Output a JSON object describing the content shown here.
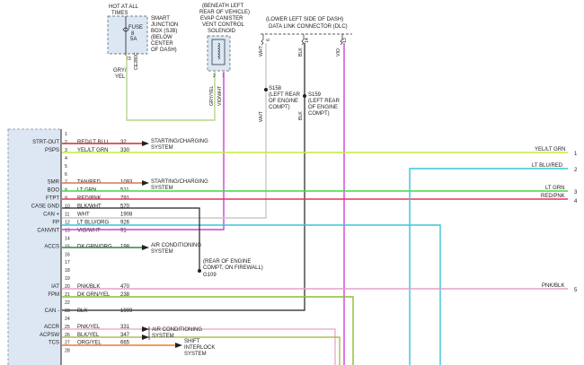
{
  "header": {
    "fuse_box_note": [
      "HOT AT ALL",
      "TIMES"
    ],
    "fuse_box_label": [
      "SMART",
      "JUNCTION",
      "BOX (SJB)",
      "(BELOW",
      "CENTER",
      "OF DASH)"
    ],
    "fuse_name": "FUSE",
    "fuse_number": "8",
    "fuse_rating": "5A",
    "fuse_pin": "23",
    "fuse_circuit": "CE280C",
    "fuse_wire_color": [
      "GRY/",
      "YEL"
    ],
    "evap_label": [
      "(BENEATH LEFT",
      "REAR OF VEHICLE)",
      "EVAP CANISTER",
      "VENT CONTROL",
      "SOLENOID"
    ],
    "evap_pin_1": "2",
    "evap_pin_2": "1",
    "evap_wire_1": "GRY/YEL",
    "evap_wire_2": "VIO/WHT",
    "dlc_label": [
      "(LOWER LEFT SIDE OF DASH)",
      "DATA LINK CONNECTOR (DLC)"
    ],
    "dlc_pins": [
      "6",
      "14",
      "13"
    ],
    "dlc_wires": [
      "WHT",
      "BLK",
      "VIO"
    ],
    "splice_s158": [
      "S158",
      "(LEFT REAR",
      "OF ENGINE",
      "COMPT)"
    ],
    "splice_s159": [
      "S159",
      "(LEFT REAR",
      "OF ENGINE",
      "COMPT)"
    ],
    "splice_wire_wht": "WHT",
    "splice_wire_blk": "BLK",
    "ground_label": [
      "(REAR OF ENGINE",
      "COMPT, ON FIREWALL)",
      "G109"
    ]
  },
  "pins": [
    {
      "n": "1",
      "name": "",
      "color": "",
      "circuit": ""
    },
    {
      "n": "2",
      "name": "STRT-OUT",
      "color": "RED/LT BLU",
      "circuit": "32"
    },
    {
      "n": "3",
      "name": "PSPS",
      "color": "YEL/LT GRN",
      "circuit": "330"
    },
    {
      "n": "4",
      "name": "",
      "color": "",
      "circuit": ""
    },
    {
      "n": "5",
      "name": "",
      "color": "",
      "circuit": ""
    },
    {
      "n": "6",
      "name": "",
      "color": "",
      "circuit": ""
    },
    {
      "n": "7",
      "name": "SMR",
      "color": "TAN/RED",
      "circuit": "1093"
    },
    {
      "n": "8",
      "name": "BOO",
      "color": "LT GRN",
      "circuit": "511"
    },
    {
      "n": "9",
      "name": "FTPT",
      "color": "RED/PNK",
      "circuit": "791"
    },
    {
      "n": "10",
      "name": "CASE GND",
      "color": "BLK/WHT",
      "circuit": "570"
    },
    {
      "n": "11",
      "name": "CAN +",
      "color": "WHT",
      "circuit": "1908"
    },
    {
      "n": "12",
      "name": "FP",
      "color": "LT BLU/ORG",
      "circuit": "926"
    },
    {
      "n": "13",
      "name": "CANVNT",
      "color": "VIO/WHT",
      "circuit": "91"
    },
    {
      "n": "14",
      "name": "",
      "color": "",
      "circuit": ""
    },
    {
      "n": "15",
      "name": "ACCS",
      "color": "DK GRN/ORG",
      "circuit": "198"
    },
    {
      "n": "16",
      "name": "",
      "color": "",
      "circuit": ""
    },
    {
      "n": "17",
      "name": "",
      "color": "",
      "circuit": ""
    },
    {
      "n": "18",
      "name": "",
      "color": "",
      "circuit": ""
    },
    {
      "n": "19",
      "name": "",
      "color": "",
      "circuit": ""
    },
    {
      "n": "20",
      "name": "IAT",
      "color": "PNK/BLK",
      "circuit": "470"
    },
    {
      "n": "21",
      "name": "FPM",
      "color": "DK GRN/YEL",
      "circuit": "238"
    },
    {
      "n": "22",
      "name": "",
      "color": "",
      "circuit": ""
    },
    {
      "n": "23",
      "name": "CAN -",
      "color": "BLK",
      "circuit": "1909"
    },
    {
      "n": "24",
      "name": "",
      "color": "",
      "circuit": ""
    },
    {
      "n": "25",
      "name": "ACCR",
      "color": "PNK/YEL",
      "circuit": "331"
    },
    {
      "n": "26",
      "name": "ACPSW",
      "color": "BLK/YEL",
      "circuit": "347"
    },
    {
      "n": "27",
      "name": "TCS",
      "color": "ORG/YEL",
      "circuit": "665"
    },
    {
      "n": "28",
      "name": "",
      "color": "",
      "circuit": ""
    }
  ],
  "destinations": {
    "starting_charging_1": [
      "STARTING/CHARGING",
      "SYSTEM"
    ],
    "starting_charging_2": [
      "STARTING/CHARGING",
      "SYSTEM"
    ],
    "ac_1": [
      "AIR CONDITIONING",
      "SYSTEM"
    ],
    "ac_2": [
      "AIR CONDITIONING",
      "SYSTEM"
    ],
    "shift_interlock": [
      "SHIFT",
      "INTERLOCK",
      "SYSTEM"
    ]
  },
  "offpage": [
    {
      "label": "YEL/LT GRN",
      "num": "1"
    },
    {
      "label": "LT BLU/RED",
      "num": "2"
    },
    {
      "label": "LT GRN",
      "num": "3"
    },
    {
      "label": "RED/PNK",
      "num": "4"
    },
    {
      "label": "PNK/BLK",
      "num": "5"
    }
  ],
  "wire_colors": {
    "yel_lt_grn": "#c4ec3c",
    "lt_grn": "#3fdc3f",
    "red_pnk": "#e8315b",
    "lt_blu": "#39c5d6",
    "vio_wht": "#d040d8",
    "gry_yel": "#b9d48c",
    "red": "#d42a2a",
    "black": "#222222",
    "wht": "#c8c8c8",
    "dk_grn": "#2f8a3a",
    "orange": "#f07b2a",
    "pink": "#e6a0c8",
    "dk_grn_yel": "#8cbf2a"
  }
}
